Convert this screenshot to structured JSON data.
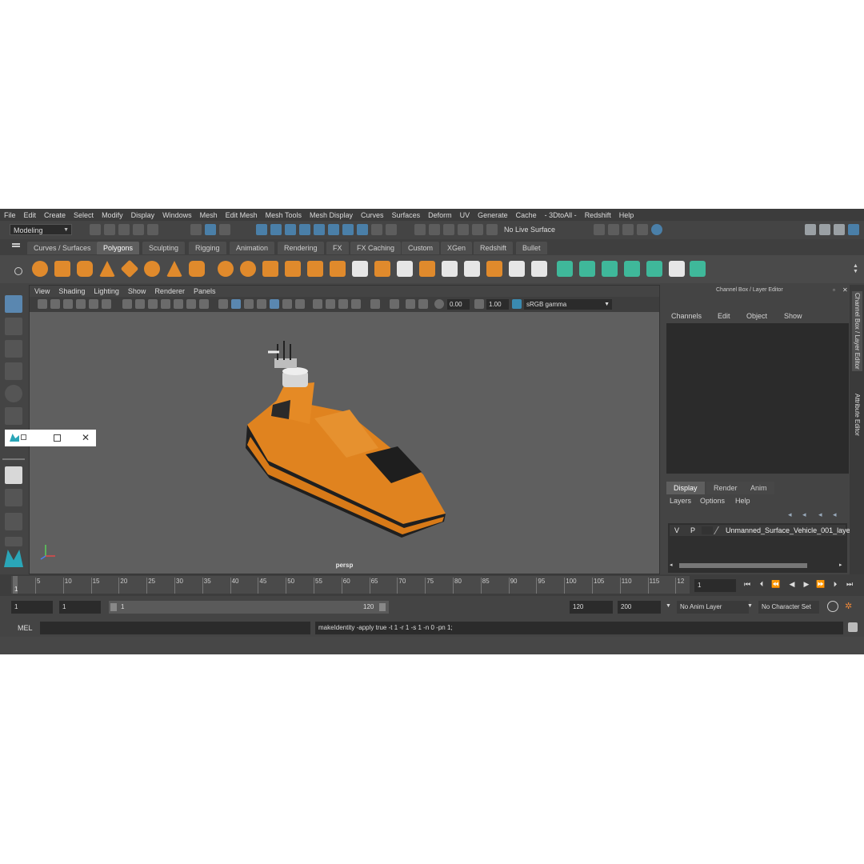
{
  "menus": [
    "File",
    "Edit",
    "Create",
    "Select",
    "Modify",
    "Display",
    "Windows",
    "Mesh",
    "Edit Mesh",
    "Mesh Tools",
    "Mesh Display",
    "Curves",
    "Surfaces",
    "Deform",
    "UV",
    "Generate",
    "Cache",
    "- 3DtoAll -",
    "Redshift",
    "Help"
  ],
  "status": {
    "mode": "Modeling",
    "live_surface": "No Live Surface"
  },
  "shelf_tabs": [
    "Curves / Surfaces",
    "Polygons",
    "Sculpting",
    "Rigging",
    "Animation",
    "Rendering",
    "FX",
    "FX Caching",
    "Custom",
    "XGen",
    "Redshift",
    "Bullet"
  ],
  "active_shelf_tab": "Polygons",
  "viewport": {
    "menus": [
      "View",
      "Shading",
      "Lighting",
      "Show",
      "Renderer",
      "Panels"
    ],
    "exposure": "0.00",
    "gamma": "1.00",
    "color_space": "sRGB gamma",
    "camera_label": "persp"
  },
  "channel_box": {
    "title": "Channel Box / Layer Editor",
    "menus": [
      "Channels",
      "Edit",
      "Object",
      "Show"
    ]
  },
  "layer_editor": {
    "tabs": [
      "Display",
      "Render",
      "Anim"
    ],
    "active_tab": "Display",
    "menus": [
      "Layers",
      "Options",
      "Help"
    ],
    "layer": {
      "v": "V",
      "p": "P",
      "name": "Unmanned_Surface_Vehicle_001_laye"
    }
  },
  "side_tabs": [
    "Channel Box / Layer Editor",
    "Attribute Editor"
  ],
  "timeline": {
    "ticks": [
      "5",
      "10",
      "15",
      "20",
      "25",
      "30",
      "35",
      "40",
      "45",
      "50",
      "55",
      "60",
      "65",
      "70",
      "75",
      "80",
      "85",
      "90",
      "95",
      "100",
      "105",
      "110",
      "115",
      "12"
    ],
    "start_marker": "1",
    "current_frame": "1"
  },
  "range": {
    "start": "1",
    "playback_start": "1",
    "slider_start": "1",
    "slider_end": "120",
    "playback_end": "120",
    "end": "200",
    "anim_layer": "No Anim Layer",
    "char_set": "No Character Set"
  },
  "command": {
    "language": "MEL",
    "feedback": "makeIdentity -apply true -t 1 -r 1 -s 1 -n 0 -pn 1;"
  },
  "colors": {
    "accent": "#5a87b0",
    "boat_orange": "#e0831f",
    "shelf_orange": "#e08a2c"
  }
}
